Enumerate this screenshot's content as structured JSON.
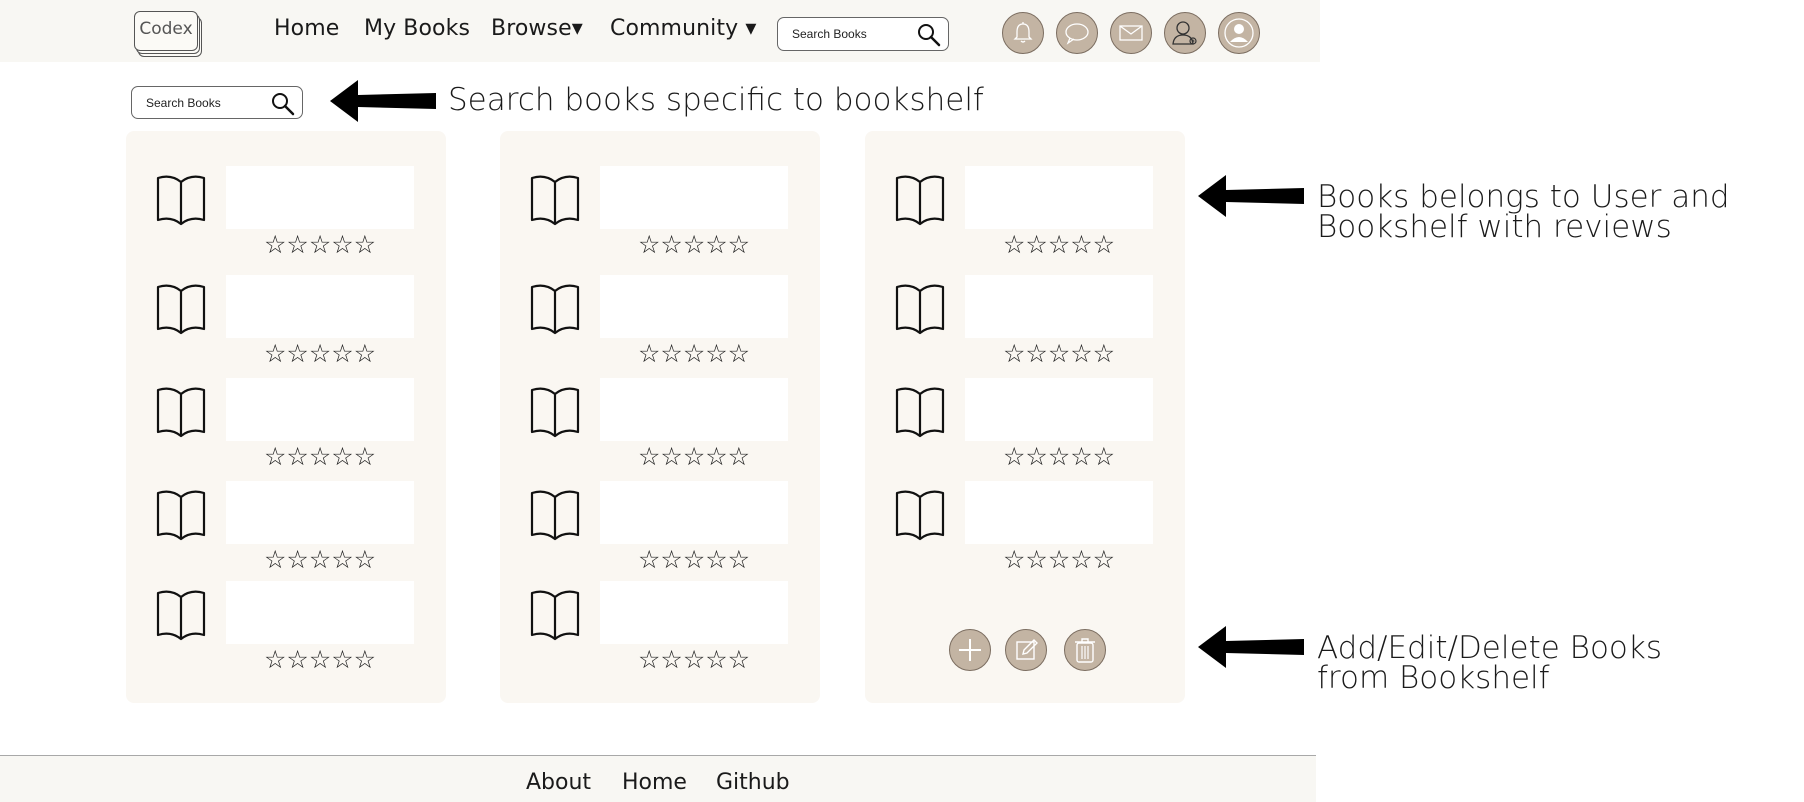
{
  "app": {
    "logo_text": "Codex"
  },
  "nav": {
    "home": "Home",
    "my_books": "My Books",
    "browse": "Browse▾",
    "community": "Community ▾",
    "search_placeholder": "Search Books",
    "icons": [
      "bell-icon",
      "chat-icon",
      "mail-icon",
      "add-friend-icon",
      "profile-icon"
    ]
  },
  "shelf_search": {
    "placeholder": "Search Books"
  },
  "annotations": {
    "search_note": "Search books specific to bookshelf",
    "books_note_line1": "Books belongs to User and",
    "books_note_line2": "Bookshelf with reviews",
    "actions_note_line1": "Add/Edit/Delete Books",
    "actions_note_line2": "from Bookshelf"
  },
  "shelves": [
    {
      "books": [
        {
          "title": "",
          "rating": "☆☆☆☆☆"
        },
        {
          "title": "",
          "rating": "☆☆☆☆☆"
        },
        {
          "title": "",
          "rating": "☆☆☆☆☆"
        },
        {
          "title": "",
          "rating": "☆☆☆☆☆"
        },
        {
          "title": "",
          "rating": "☆☆☆☆☆"
        }
      ]
    },
    {
      "books": [
        {
          "title": "",
          "rating": "☆☆☆☆☆"
        },
        {
          "title": "",
          "rating": "☆☆☆☆☆"
        },
        {
          "title": "",
          "rating": "☆☆☆☆☆"
        },
        {
          "title": "",
          "rating": "☆☆☆☆☆"
        },
        {
          "title": "",
          "rating": "☆☆☆☆☆"
        }
      ]
    },
    {
      "books": [
        {
          "title": "",
          "rating": "☆☆☆☆☆"
        },
        {
          "title": "",
          "rating": "☆☆☆☆☆"
        },
        {
          "title": "",
          "rating": "☆☆☆☆☆"
        },
        {
          "title": "",
          "rating": "☆☆☆☆☆"
        }
      ],
      "actions": [
        "add-icon",
        "edit-icon",
        "trash-icon"
      ]
    }
  ],
  "footer": {
    "about": "About",
    "home": "Home",
    "github": "Github"
  },
  "colors": {
    "button_fill": "#c3b4a3",
    "shelf_bg": "#faf7f2",
    "bar_bg": "#f8f7f3"
  }
}
